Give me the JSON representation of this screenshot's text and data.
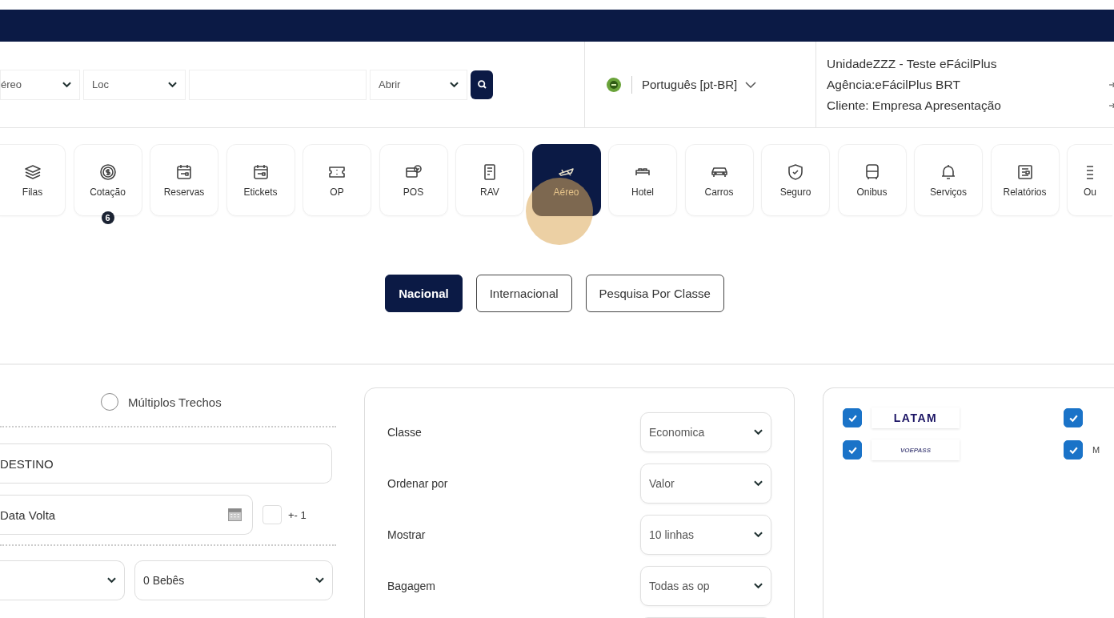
{
  "header": {
    "selects": [
      {
        "value": "éreo"
      },
      {
        "value": "Loc"
      }
    ],
    "open_select": {
      "value": "Abrir"
    },
    "language": "Português [pt-BR]",
    "info_lines": [
      {
        "text": "UnidadeZZZ - Teste eFácilPlus",
        "kind": "title"
      },
      {
        "text": "Agência:eFácilPlus BRT",
        "kind": "link"
      },
      {
        "text": "Cliente:  Empresa Apresentação",
        "kind": "link"
      }
    ]
  },
  "modules": [
    {
      "label": "Filas",
      "selected": false
    },
    {
      "label": "Cotação",
      "selected": false,
      "badge": "6"
    },
    {
      "label": "Reservas",
      "selected": false
    },
    {
      "label": "Etickets",
      "selected": false
    },
    {
      "label": "OP",
      "selected": false
    },
    {
      "label": "POS",
      "selected": false
    },
    {
      "label": "RAV",
      "selected": false
    },
    {
      "label": "Aéreo",
      "selected": true
    },
    {
      "label": "Hotel",
      "selected": false
    },
    {
      "label": "Carros",
      "selected": false
    },
    {
      "label": "Seguro",
      "selected": false
    },
    {
      "label": "Onibus",
      "selected": false
    },
    {
      "label": "Serviços",
      "selected": false
    },
    {
      "label": "Relatórios",
      "selected": false
    },
    {
      "label": "Ou",
      "selected": false
    }
  ],
  "search_types": [
    {
      "label": "Nacional",
      "selected": true
    },
    {
      "label": "Internacional",
      "selected": false
    },
    {
      "label": "Pesquisa Por Classe",
      "selected": false
    }
  ],
  "route": {
    "multi_leg": {
      "label": "Múltiplos Trechos",
      "selected": false
    },
    "destination": {
      "placeholder": "DESTINO"
    },
    "return_date": {
      "placeholder": "Data Volta"
    },
    "flex_dates": {
      "label": "+- 1",
      "checked": false
    },
    "infants": {
      "value": "0 Bebês"
    }
  },
  "options": [
    {
      "label": "Classe",
      "value": "Economica"
    },
    {
      "label": "Ordenar por",
      "value": "Valor"
    },
    {
      "label": "Mostrar",
      "value": "10 linhas"
    },
    {
      "label": "Bagagem",
      "value": "Todas as op"
    }
  ],
  "airlines": [
    {
      "name": "LATAM",
      "kind": "latam",
      "checked": true
    },
    {
      "kind": "blank",
      "checked": true
    },
    {
      "name": "VOEPASS",
      "kind": "voepass",
      "checked": true
    },
    {
      "name": "M",
      "kind": "text",
      "checked": true
    }
  ]
}
